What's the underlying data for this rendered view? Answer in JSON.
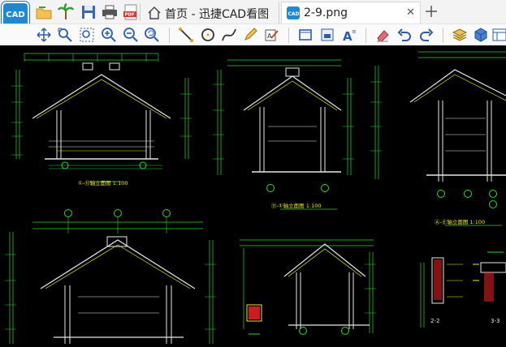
{
  "app": {
    "logo_text": "CAD"
  },
  "tabs": [
    {
      "label": "首页 - 迅捷CAD看图",
      "icon": "home-icon"
    },
    {
      "label": "2-9.png",
      "icon": "cad-file-icon",
      "active": true
    }
  ],
  "quick_toolbar": [
    "open-folder-icon",
    "palm-tree-icon",
    "save-icon",
    "print-icon",
    "pdf-icon"
  ],
  "view_toolbar": [
    "pan-icon",
    "zoom-window-icon",
    "zoom-extents-icon",
    "zoom-in-icon",
    "zoom-out-icon",
    "zoom-previous-icon",
    "line-icon",
    "circle-icon",
    "curve-icon",
    "pen-icon",
    "text-edit-icon",
    "frame-icon",
    "layout-icon",
    "text-style-icon",
    "eraser-icon",
    "undo-icon",
    "redo-icon",
    "layers-icon",
    "cube-icon",
    "panel-icon"
  ],
  "drawing": {
    "captions": [
      "①-⑪轴立面图 1:100",
      "⑪-①轴立面图 1:100",
      "Ⓐ-Ⓔ轴立面图 1:100"
    ],
    "section_labels": [
      "2-2",
      "3-3"
    ],
    "grid_bubbles": [
      "①",
      "⑪",
      "Ⓑ",
      "Ⓒ",
      "Ⓓ",
      "Ⓕ",
      "Ⓖ",
      "Ⓗ",
      "Ⓘ",
      "⑳",
      "⑳"
    ]
  },
  "colors": {
    "canvas_bg": "#000000",
    "tab_active": "#ffffff",
    "accent": "#1e88d6",
    "cad_green": "#22dd22",
    "cad_yellow": "#eeee11",
    "cad_white": "#e8e8e8",
    "cad_red": "#ee2222"
  }
}
